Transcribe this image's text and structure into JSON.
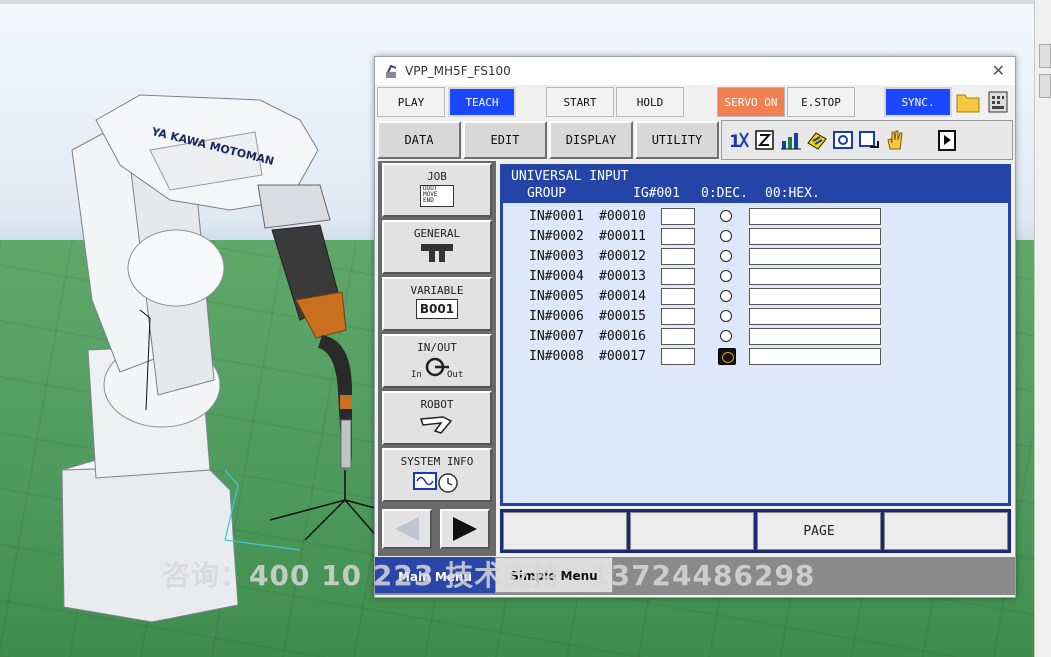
{
  "window": {
    "title": "VPP_MH5F_FS100"
  },
  "top_buttons": {
    "play": "PLAY",
    "teach": "TEACH",
    "start": "START",
    "hold": "HOLD",
    "servo_on": "SERVO ON",
    "estop": "E.STOP",
    "sync": "SYNC."
  },
  "menu_buttons": {
    "data": "DATA",
    "edit": "EDIT",
    "display": "DISPLAY",
    "utility": "UTILITY"
  },
  "toolbar_icons": [
    "coordinate-icon",
    "edit-icon",
    "chart-icon",
    "speed-icon",
    "camera-icon",
    "export-icon",
    "hand-icon",
    "next-page-icon"
  ],
  "left_menu": {
    "job": {
      "label": "JOB",
      "icon_text": [
        "DOUT",
        "MOVE",
        "END"
      ]
    },
    "general": {
      "label": "GENERAL"
    },
    "variable": {
      "label": "VARIABLE",
      "value": "B001"
    },
    "inout": {
      "label": "IN/OUT",
      "in": "In",
      "out": "Out"
    },
    "robot": {
      "label": "ROBOT"
    },
    "system_info": {
      "label": "SYSTEM INFO"
    }
  },
  "panel": {
    "title": "UNIVERSAL INPUT",
    "group_label": "GROUP",
    "group_value": "IG#001",
    "mode_dec": "0:DEC.",
    "mode_hex": "00:HEX.",
    "rows": [
      {
        "input": "IN#0001",
        "addr": "#00010",
        "on": false
      },
      {
        "input": "IN#0002",
        "addr": "#00011",
        "on": false
      },
      {
        "input": "IN#0003",
        "addr": "#00012",
        "on": false
      },
      {
        "input": "IN#0004",
        "addr": "#00013",
        "on": false
      },
      {
        "input": "IN#0005",
        "addr": "#00014",
        "on": false
      },
      {
        "input": "IN#0006",
        "addr": "#00015",
        "on": false
      },
      {
        "input": "IN#0007",
        "addr": "#00016",
        "on": false
      },
      {
        "input": "IN#0008",
        "addr": "#00017",
        "on": true
      }
    ]
  },
  "bottom_buttons": [
    "",
    "",
    "PAGE",
    ""
  ],
  "tabs": {
    "main": "Main Menu",
    "simple": "Simple Menu"
  },
  "watermark": "咨询：400 10 223  技术支持：13724486298",
  "robot_logo": "YA KAWA MOTOMAN"
}
